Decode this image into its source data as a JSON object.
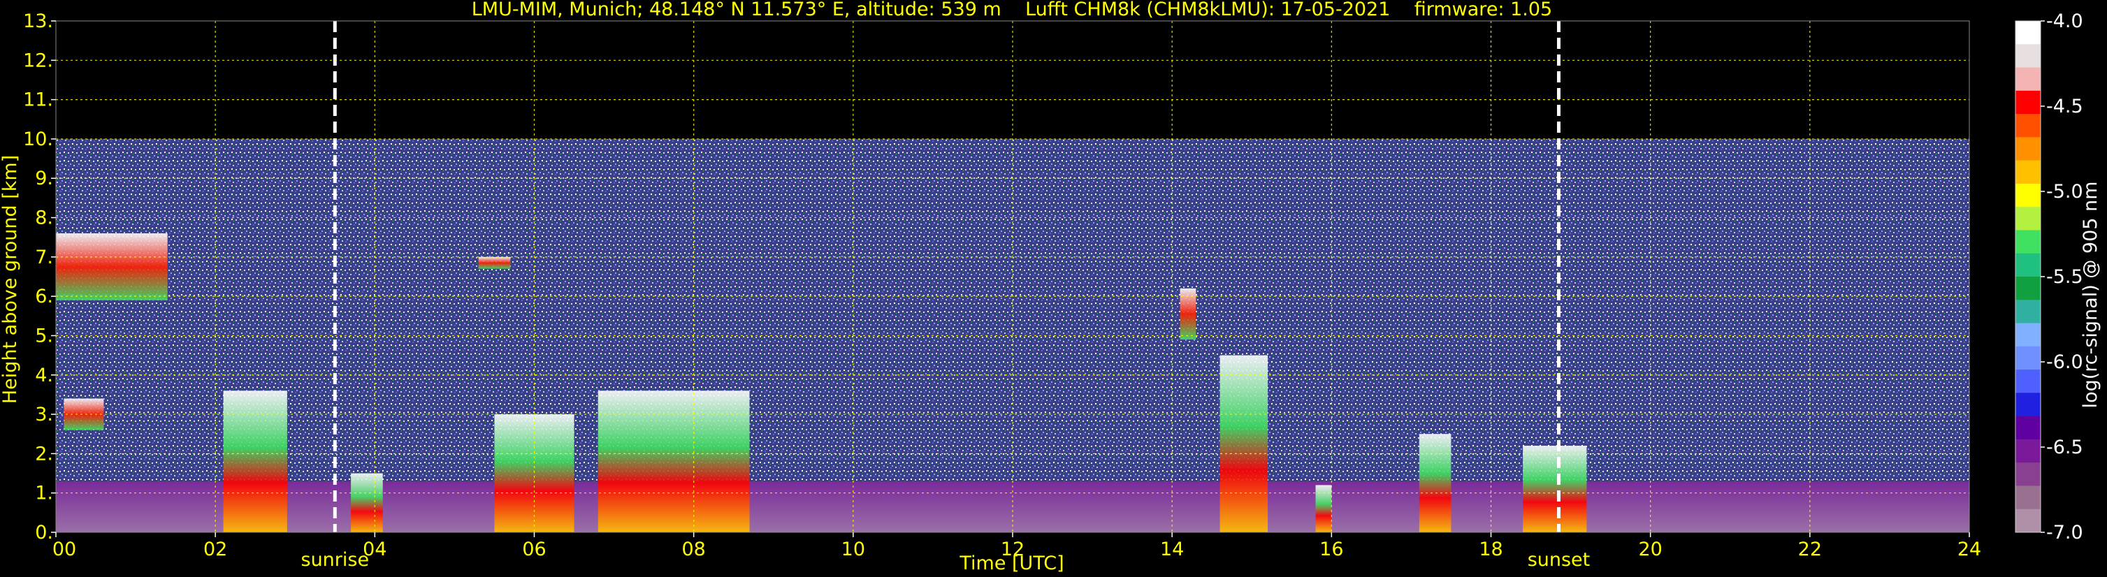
{
  "chart_data": {
    "type": "heatmap",
    "title": "LMU-MIM, Munich; 48.148° N 11.573° E, altitude: 539 m    Lufft CHM8k (CHM8kLMU): 17-05-2021    firmware: 1.05",
    "xlabel": "Time [UTC]",
    "ylabel": "Height above ground [km]",
    "xlim": [
      0,
      24
    ],
    "ylim": [
      0,
      13
    ],
    "x_ticks": [
      "00",
      "02",
      "04",
      "06",
      "08",
      "10",
      "12",
      "14",
      "16",
      "18",
      "20",
      "22",
      "24"
    ],
    "y_ticks": [
      "0.",
      "1.",
      "2.",
      "3.",
      "4.",
      "5.",
      "6.",
      "7.",
      "8.",
      "9.",
      "10.",
      "11.",
      "12.",
      "13."
    ],
    "grid": true,
    "data_top_km": 10,
    "events": [
      {
        "label": "sunrise",
        "time_h": 3.5
      },
      {
        "label": "sunset",
        "time_h": 18.85
      }
    ],
    "colorbar": {
      "label": "log(rc-signal) @ 905 nm",
      "range": [
        -7.0,
        -4.0
      ],
      "ticks": [
        "-4.0",
        "-4.5",
        "-5.0",
        "-5.5",
        "-6.0",
        "-6.5",
        "-7.0"
      ],
      "colors": [
        "#ffffff",
        "#e8e0e0",
        "#f4b4b4",
        "#ff0000",
        "#ff5000",
        "#ff9000",
        "#ffc000",
        "#ffff00",
        "#b4f040",
        "#40e060",
        "#20c080",
        "#10a040",
        "#30b0a0",
        "#80b0ff",
        "#7090ff",
        "#5060ff",
        "#2020e0",
        "#6000a0",
        "#7a1a9a",
        "#8a4090",
        "#9a7090",
        "#b090a8"
      ]
    },
    "features": [
      {
        "kind": "cloud",
        "t0": 0.0,
        "t1": 1.4,
        "z0": 5.9,
        "z1": 7.6
      },
      {
        "kind": "cloud",
        "t0": 0.1,
        "t1": 0.6,
        "z0": 2.6,
        "z1": 3.4
      },
      {
        "kind": "cloud",
        "t0": 5.3,
        "t1": 5.7,
        "z0": 6.7,
        "z1": 7.0
      },
      {
        "kind": "cloud",
        "t0": 14.1,
        "t1": 14.3,
        "z0": 4.9,
        "z1": 6.2
      },
      {
        "kind": "precip",
        "t0": 2.1,
        "t1": 2.9,
        "z0": 0.0,
        "z1": 3.6
      },
      {
        "kind": "precip",
        "t0": 3.7,
        "t1": 4.1,
        "z0": 0.0,
        "z1": 1.5
      },
      {
        "kind": "precip",
        "t0": 5.5,
        "t1": 6.5,
        "z0": 0.0,
        "z1": 3.0
      },
      {
        "kind": "precip",
        "t0": 6.8,
        "t1": 8.7,
        "z0": 0.0,
        "z1": 3.6
      },
      {
        "kind": "precip",
        "t0": 14.6,
        "t1": 15.2,
        "z0": 0.0,
        "z1": 4.5
      },
      {
        "kind": "precip",
        "t0": 15.8,
        "t1": 16.0,
        "z0": 0.0,
        "z1": 1.2
      },
      {
        "kind": "precip",
        "t0": 17.1,
        "t1": 17.5,
        "z0": 0.0,
        "z1": 2.5
      },
      {
        "kind": "precip",
        "t0": 18.4,
        "t1": 19.2,
        "z0": 0.0,
        "z1": 2.2
      }
    ]
  }
}
